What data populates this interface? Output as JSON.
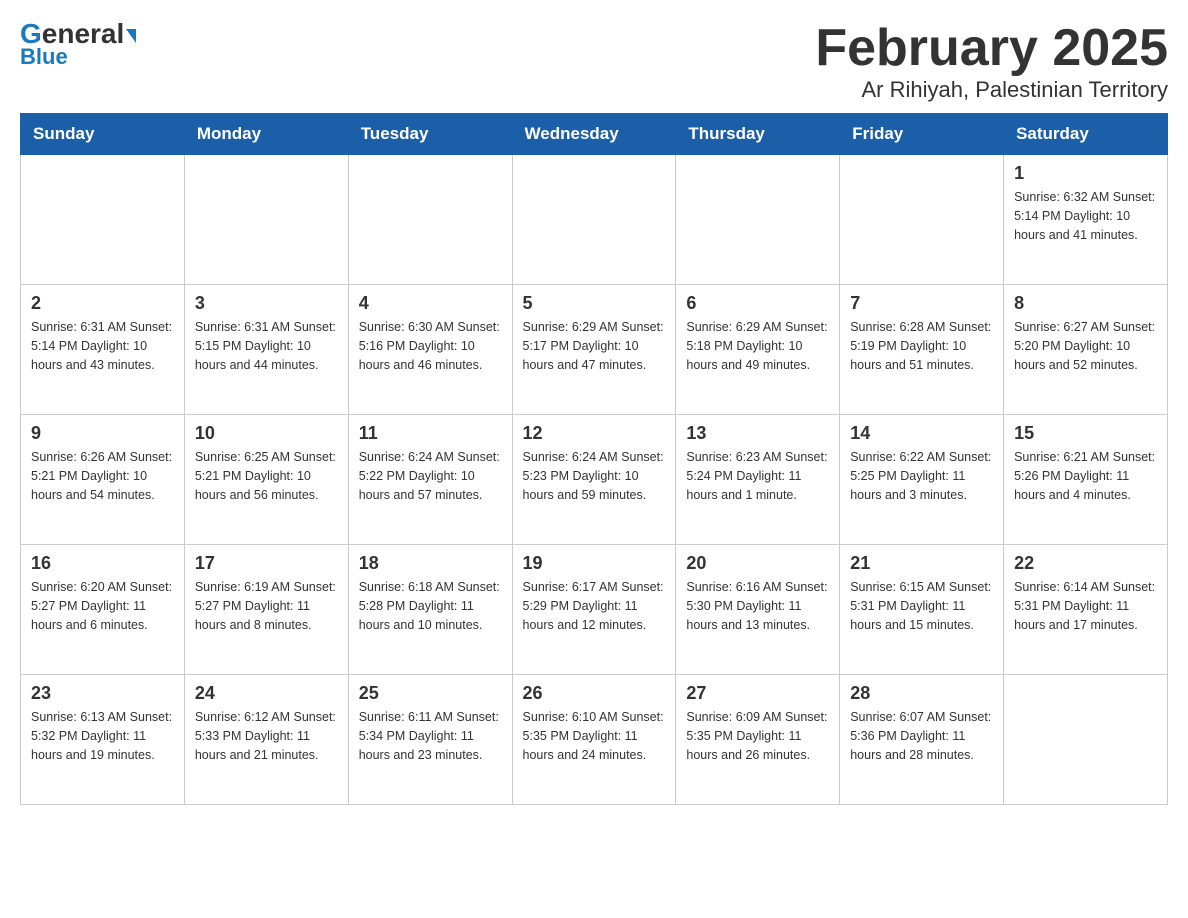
{
  "header": {
    "logo_general": "General",
    "logo_blue": "Blue",
    "title": "February 2025",
    "subtitle": "Ar Rihiyah, Palestinian Territory"
  },
  "days_of_week": [
    "Sunday",
    "Monday",
    "Tuesday",
    "Wednesday",
    "Thursday",
    "Friday",
    "Saturday"
  ],
  "weeks": [
    [
      {
        "day": "",
        "info": ""
      },
      {
        "day": "",
        "info": ""
      },
      {
        "day": "",
        "info": ""
      },
      {
        "day": "",
        "info": ""
      },
      {
        "day": "",
        "info": ""
      },
      {
        "day": "",
        "info": ""
      },
      {
        "day": "1",
        "info": "Sunrise: 6:32 AM\nSunset: 5:14 PM\nDaylight: 10 hours and 41 minutes."
      }
    ],
    [
      {
        "day": "2",
        "info": "Sunrise: 6:31 AM\nSunset: 5:14 PM\nDaylight: 10 hours and 43 minutes."
      },
      {
        "day": "3",
        "info": "Sunrise: 6:31 AM\nSunset: 5:15 PM\nDaylight: 10 hours and 44 minutes."
      },
      {
        "day": "4",
        "info": "Sunrise: 6:30 AM\nSunset: 5:16 PM\nDaylight: 10 hours and 46 minutes."
      },
      {
        "day": "5",
        "info": "Sunrise: 6:29 AM\nSunset: 5:17 PM\nDaylight: 10 hours and 47 minutes."
      },
      {
        "day": "6",
        "info": "Sunrise: 6:29 AM\nSunset: 5:18 PM\nDaylight: 10 hours and 49 minutes."
      },
      {
        "day": "7",
        "info": "Sunrise: 6:28 AM\nSunset: 5:19 PM\nDaylight: 10 hours and 51 minutes."
      },
      {
        "day": "8",
        "info": "Sunrise: 6:27 AM\nSunset: 5:20 PM\nDaylight: 10 hours and 52 minutes."
      }
    ],
    [
      {
        "day": "9",
        "info": "Sunrise: 6:26 AM\nSunset: 5:21 PM\nDaylight: 10 hours and 54 minutes."
      },
      {
        "day": "10",
        "info": "Sunrise: 6:25 AM\nSunset: 5:21 PM\nDaylight: 10 hours and 56 minutes."
      },
      {
        "day": "11",
        "info": "Sunrise: 6:24 AM\nSunset: 5:22 PM\nDaylight: 10 hours and 57 minutes."
      },
      {
        "day": "12",
        "info": "Sunrise: 6:24 AM\nSunset: 5:23 PM\nDaylight: 10 hours and 59 minutes."
      },
      {
        "day": "13",
        "info": "Sunrise: 6:23 AM\nSunset: 5:24 PM\nDaylight: 11 hours and 1 minute."
      },
      {
        "day": "14",
        "info": "Sunrise: 6:22 AM\nSunset: 5:25 PM\nDaylight: 11 hours and 3 minutes."
      },
      {
        "day": "15",
        "info": "Sunrise: 6:21 AM\nSunset: 5:26 PM\nDaylight: 11 hours and 4 minutes."
      }
    ],
    [
      {
        "day": "16",
        "info": "Sunrise: 6:20 AM\nSunset: 5:27 PM\nDaylight: 11 hours and 6 minutes."
      },
      {
        "day": "17",
        "info": "Sunrise: 6:19 AM\nSunset: 5:27 PM\nDaylight: 11 hours and 8 minutes."
      },
      {
        "day": "18",
        "info": "Sunrise: 6:18 AM\nSunset: 5:28 PM\nDaylight: 11 hours and 10 minutes."
      },
      {
        "day": "19",
        "info": "Sunrise: 6:17 AM\nSunset: 5:29 PM\nDaylight: 11 hours and 12 minutes."
      },
      {
        "day": "20",
        "info": "Sunrise: 6:16 AM\nSunset: 5:30 PM\nDaylight: 11 hours and 13 minutes."
      },
      {
        "day": "21",
        "info": "Sunrise: 6:15 AM\nSunset: 5:31 PM\nDaylight: 11 hours and 15 minutes."
      },
      {
        "day": "22",
        "info": "Sunrise: 6:14 AM\nSunset: 5:31 PM\nDaylight: 11 hours and 17 minutes."
      }
    ],
    [
      {
        "day": "23",
        "info": "Sunrise: 6:13 AM\nSunset: 5:32 PM\nDaylight: 11 hours and 19 minutes."
      },
      {
        "day": "24",
        "info": "Sunrise: 6:12 AM\nSunset: 5:33 PM\nDaylight: 11 hours and 21 minutes."
      },
      {
        "day": "25",
        "info": "Sunrise: 6:11 AM\nSunset: 5:34 PM\nDaylight: 11 hours and 23 minutes."
      },
      {
        "day": "26",
        "info": "Sunrise: 6:10 AM\nSunset: 5:35 PM\nDaylight: 11 hours and 24 minutes."
      },
      {
        "day": "27",
        "info": "Sunrise: 6:09 AM\nSunset: 5:35 PM\nDaylight: 11 hours and 26 minutes."
      },
      {
        "day": "28",
        "info": "Sunrise: 6:07 AM\nSunset: 5:36 PM\nDaylight: 11 hours and 28 minutes."
      },
      {
        "day": "",
        "info": ""
      }
    ]
  ]
}
